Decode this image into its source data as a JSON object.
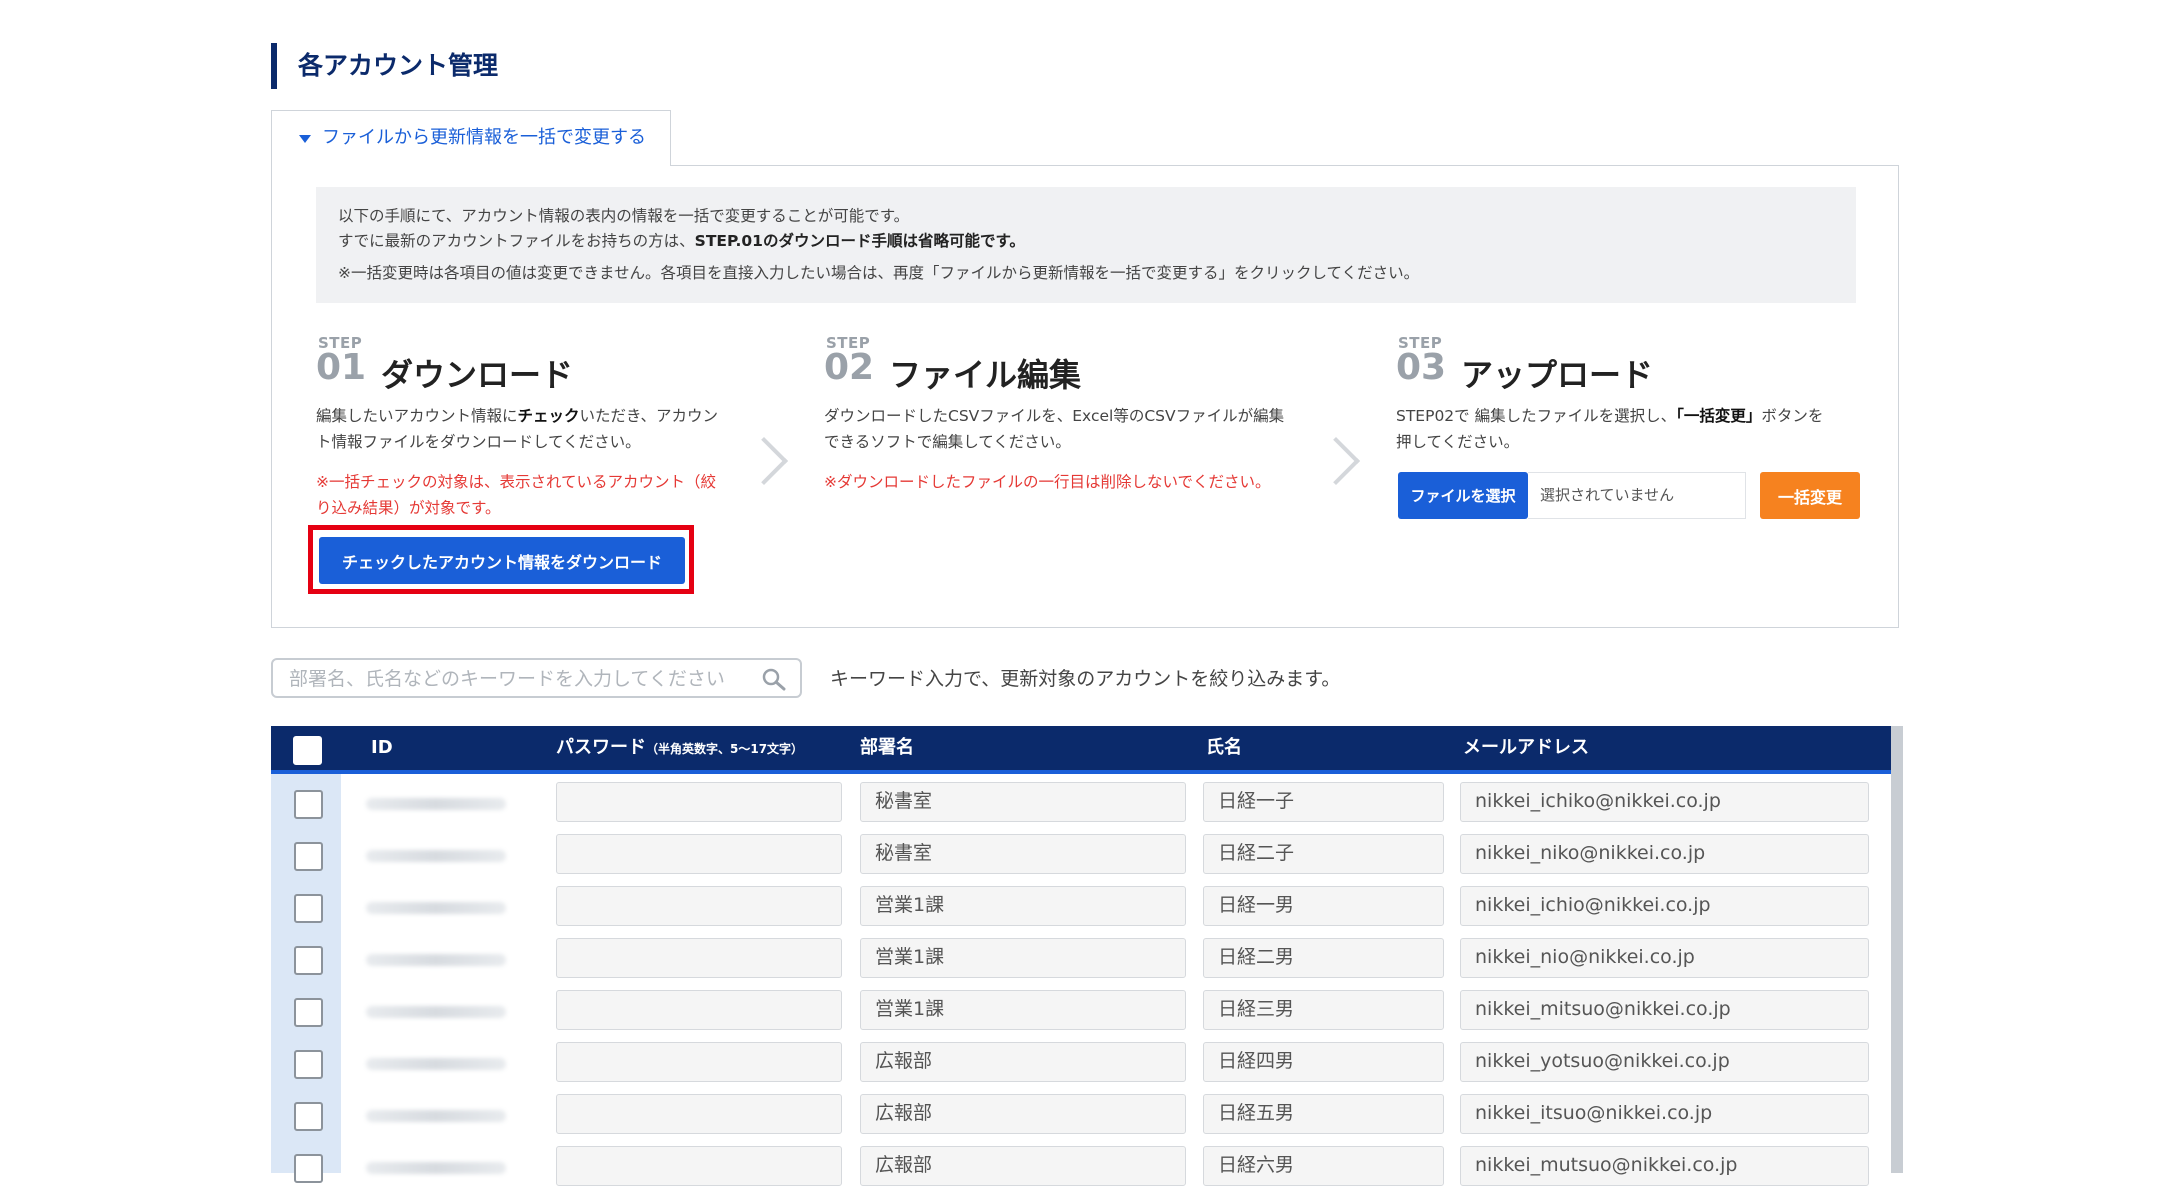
{
  "page": {
    "title": "各アカウント管理"
  },
  "tab": {
    "label": "ファイルから更新情報を一括で変更する"
  },
  "info": {
    "line1": "以下の手順にて、アカウント情報の表内の情報を一括で変更することが可能です。",
    "line2_prefix": "すでに最新のアカウントファイルをお持ちの方は、",
    "line2_bold": "STEP.01のダウンロード手順は省略可能です。",
    "line3": "※一括変更時は各項目の値は変更できません。各項目を直接入力したい場合は、再度「ファイルから更新情報を一括で変更する」をクリックしてください。"
  },
  "steps": [
    {
      "tag": "STEP",
      "number": "01",
      "title": "ダウンロード",
      "desc_l1_a": "編集したいアカウント情報に",
      "desc_l1_b": "チェック",
      "desc_l1_c": "いただき、アカウン",
      "desc_l2": "ト情報ファイルをダウンロードしてください。",
      "note_l1": "※一括チェックの対象は、表示されているアカウント（絞",
      "note_l2": "り込み結果）が対象です。",
      "button": "チェックしたアカウント情報をダウンロード"
    },
    {
      "tag": "STEP",
      "number": "02",
      "title": "ファイル編集",
      "desc_l1": "ダウンロードしたCSVファイルを、Excel等のCSVファイルが編集",
      "desc_l2": "できるソフトで編集してください。",
      "note_l1": "※ダウンロードしたファイルの一行目は削除しないでください。"
    },
    {
      "tag": "STEP",
      "number": "03",
      "title": "アップロード",
      "desc_l1_a": "STEP02で 編集したファイルを選択し、",
      "desc_l1_b": "「一括変更」",
      "desc_l1_c": "ボタンを",
      "desc_l2": "押してください。",
      "file_button": "ファイルを選択",
      "file_status": "選択されていません",
      "bulk_button": "一括変更"
    }
  ],
  "search": {
    "placeholder": "部署名、氏名などのキーワードを入力してください",
    "hint": "キーワード入力で、更新対象のアカウントを絞り込みます。"
  },
  "table": {
    "headers": {
      "id": "ID",
      "password": "パスワード",
      "password_note": "（半角英数字、5～17文字）",
      "dept": "部署名",
      "name": "氏名",
      "email": "メールアドレス"
    },
    "rows": [
      {
        "dept": "秘書室",
        "name": "日経一子",
        "email": "nikkei_ichiko@nikkei.co.jp"
      },
      {
        "dept": "秘書室",
        "name": "日経二子",
        "email": "nikkei_niko@nikkei.co.jp"
      },
      {
        "dept": "営業1課",
        "name": "日経一男",
        "email": "nikkei_ichio@nikkei.co.jp"
      },
      {
        "dept": "営業1課",
        "name": "日経二男",
        "email": "nikkei_nio@nikkei.co.jp"
      },
      {
        "dept": "営業1課",
        "name": "日経三男",
        "email": "nikkei_mitsuo@nikkei.co.jp"
      },
      {
        "dept": "広報部",
        "name": "日経四男",
        "email": "nikkei_yotsuo@nikkei.co.jp"
      },
      {
        "dept": "広報部",
        "name": "日経五男",
        "email": "nikkei_itsuo@nikkei.co.jp"
      },
      {
        "dept": "広報部",
        "name": "日経六男",
        "email": "nikkei_mutsuo@nikkei.co.jp"
      }
    ]
  },
  "colors": {
    "navy": "#0b2a6b",
    "accent_blue": "#1a5fd8",
    "orange": "#f6821f",
    "warning_red": "#e53935",
    "highlight_red": "#e50012"
  }
}
